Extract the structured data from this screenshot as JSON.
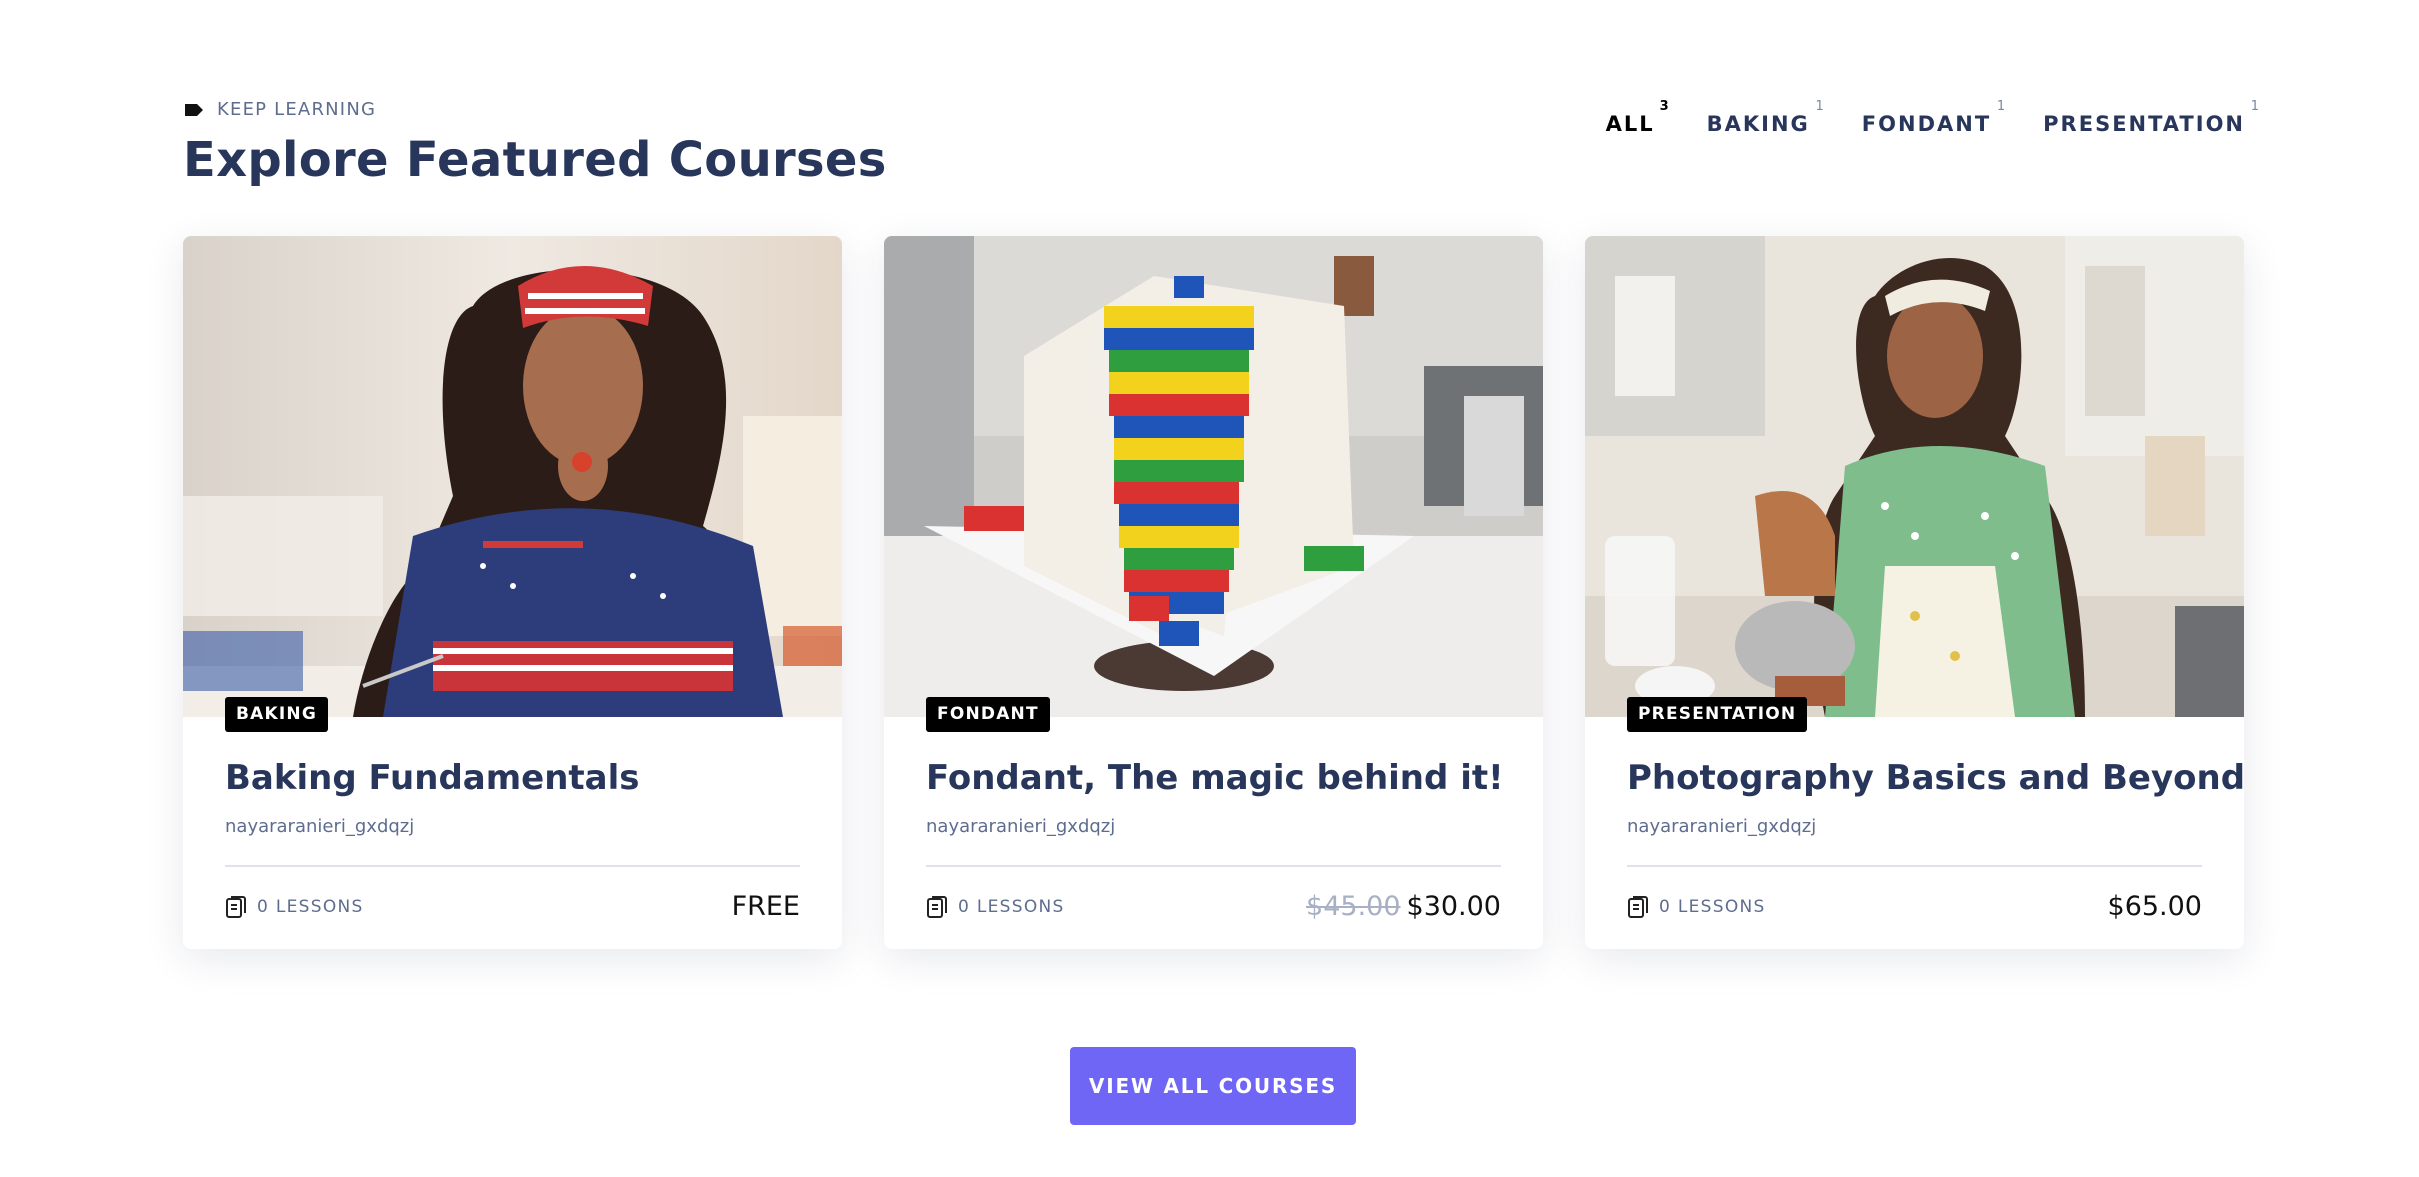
{
  "header": {
    "eyebrow": "KEEP LEARNING",
    "title": "Explore Featured Courses",
    "eyebrow_icon": "tag-icon"
  },
  "filters": [
    {
      "label": "ALL",
      "count": "3",
      "active": true
    },
    {
      "label": "BAKING",
      "count": "1",
      "active": false
    },
    {
      "label": "FONDANT",
      "count": "1",
      "active": false
    },
    {
      "label": "PRESENTATION",
      "count": "1",
      "active": false
    }
  ],
  "courses": [
    {
      "image": "baker-with-striped-headband-photo",
      "badge": "BAKING",
      "title": "Baking Fundamentals",
      "author": "nayararanieri_gxdqzj",
      "lessons": "0 LESSONS",
      "old_price": "",
      "price": "FREE"
    },
    {
      "image": "lego-fondant-cake-photo",
      "badge": "FONDANT",
      "title": "Fondant, The magic behind it!",
      "author": "nayararanieri_gxdqzj",
      "lessons": "0 LESSONS",
      "old_price": "$45.00",
      "price": "$30.00"
    },
    {
      "image": "baker-in-kitchen-with-mixer-photo",
      "badge": "PRESENTATION",
      "title": "Photography Basics and Beyond",
      "author": "nayararanieri_gxdqzj",
      "lessons": "0 LESSONS",
      "old_price": "",
      "price": "$65.00"
    }
  ],
  "cta": {
    "label": "VIEW ALL COURSES"
  },
  "colors": {
    "primary": "#7066f6",
    "heading": "#27365a",
    "muted": "#5e6d8f",
    "badge_bg": "#000000"
  }
}
